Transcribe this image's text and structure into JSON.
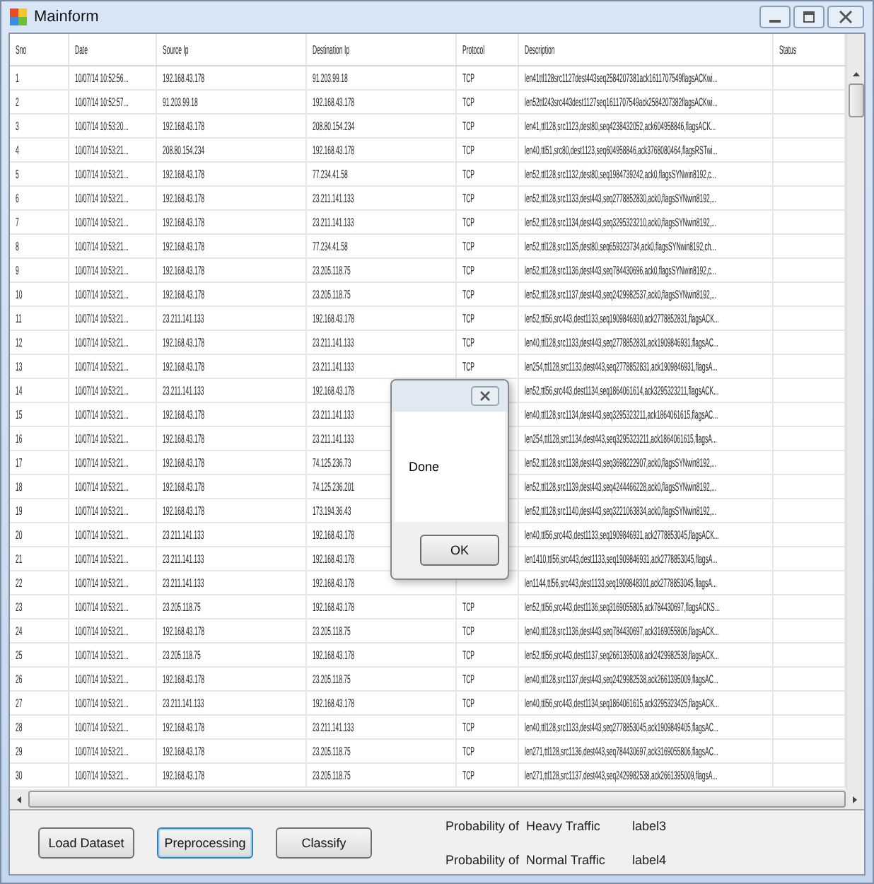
{
  "window": {
    "title": "Mainform"
  },
  "table": {
    "columns": [
      "Sno",
      "Date",
      "Source Ip",
      "Destination Ip",
      "Protocol",
      "Description",
      "Status"
    ],
    "rows": [
      {
        "sno": "1",
        "date": "10/07/14 10:52:56...",
        "source_ip": "192.168.43.178",
        "destination_ip": "91.203.99.18",
        "protocol": "TCP",
        "description": "len41ttl128src1127dest443seq2584207381ack1611707549flagsACKwi..."
      },
      {
        "sno": "2",
        "date": "10/07/14 10:52:57...",
        "source_ip": "91.203.99.18",
        "destination_ip": "192.168.43.178",
        "protocol": "TCP",
        "description": "len52ttl243src443dest1127seq1611707549ack2584207382flagsACKwi..."
      },
      {
        "sno": "3",
        "date": "10/07/14 10:53:20...",
        "source_ip": "192.168.43.178",
        "destination_ip": "208.80.154.234",
        "protocol": "TCP",
        "description": "len41,ttl128,src1123,dest80,seq4238432052,ack604958846,flagsACK..."
      },
      {
        "sno": "4",
        "date": "10/07/14 10:53:21...",
        "source_ip": "208.80.154.234",
        "destination_ip": "192.168.43.178",
        "protocol": "TCP",
        "description": "len40,ttl51,src80,dest1123,seq604958846,ack3768080464,flagsRSTwi..."
      },
      {
        "sno": "5",
        "date": "10/07/14 10:53:21...",
        "source_ip": "192.168.43.178",
        "destination_ip": "77.234.41.58",
        "protocol": "TCP",
        "description": "len52,ttl128,src1132,dest80,seq1984739242,ack0,flagsSYNwin8192,c..."
      },
      {
        "sno": "6",
        "date": "10/07/14 10:53:21...",
        "source_ip": "192.168.43.178",
        "destination_ip": "23.211.141.133",
        "protocol": "TCP",
        "description": "len52,ttl128,src1133,dest443,seq2778852830,ack0,flagsSYNwin8192,..."
      },
      {
        "sno": "7",
        "date": "10/07/14 10:53:21...",
        "source_ip": "192.168.43.178",
        "destination_ip": "23.211.141.133",
        "protocol": "TCP",
        "description": "len52,ttl128,src1134,dest443,seq3295323210,ack0,flagsSYNwin8192,..."
      },
      {
        "sno": "8",
        "date": "10/07/14 10:53:21...",
        "source_ip": "192.168.43.178",
        "destination_ip": "77.234.41.58",
        "protocol": "TCP",
        "description": "len52,ttl128,src1135,dest80,seq659323734,ack0,flagsSYNwin8192,ch..."
      },
      {
        "sno": "9",
        "date": "10/07/14 10:53:21...",
        "source_ip": "192.168.43.178",
        "destination_ip": "23.205.118.75",
        "protocol": "TCP",
        "description": "len52,ttl128,src1136,dest443,seq784430696,ack0,flagsSYNwin8192,c..."
      },
      {
        "sno": "10",
        "date": "10/07/14 10:53:21...",
        "source_ip": "192.168.43.178",
        "destination_ip": "23.205.118.75",
        "protocol": "TCP",
        "description": "len52,ttl128,src1137,dest443,seq2429982537,ack0,flagsSYNwin8192,..."
      },
      {
        "sno": "11",
        "date": "10/07/14 10:53:21...",
        "source_ip": "23.211.141.133",
        "destination_ip": "192.168.43.178",
        "protocol": "TCP",
        "description": "len52,ttl56,src443,dest1133,seq1909846930,ack2778852831,flagsACK..."
      },
      {
        "sno": "12",
        "date": "10/07/14 10:53:21...",
        "source_ip": "192.168.43.178",
        "destination_ip": "23.211.141.133",
        "protocol": "TCP",
        "description": "len40,ttl128,src1133,dest443,seq2778852831,ack1909846931,flagsAC..."
      },
      {
        "sno": "13",
        "date": "10/07/14 10:53:21...",
        "source_ip": "192.168.43.178",
        "destination_ip": "23.211.141.133",
        "protocol": "TCP",
        "description": "len254,ttl128,src1133,dest443,seq2778852831,ack1909846931,flagsA..."
      },
      {
        "sno": "14",
        "date": "10/07/14 10:53:21...",
        "source_ip": "23.211.141.133",
        "destination_ip": "192.168.43.178",
        "description": "len52,ttl56,src443,dest1134,seq1864061614,ack3295323211,flagsACK..."
      },
      {
        "sno": "15",
        "date": "10/07/14 10:53:21...",
        "source_ip": "192.168.43.178",
        "destination_ip": "23.211.141.133",
        "description": "len40,ttl128,src1134,dest443,seq3295323211,ack1864061615,flagsAC..."
      },
      {
        "sno": "16",
        "date": "10/07/14 10:53:21...",
        "source_ip": "192.168.43.178",
        "destination_ip": "23.211.141.133",
        "description": "len254,ttl128,src1134,dest443,seq3295323211,ack1864061615,flagsA..."
      },
      {
        "sno": "17",
        "date": "10/07/14 10:53:21...",
        "source_ip": "192.168.43.178",
        "destination_ip": "74.125.236.73",
        "description": "len52,ttl128,src1138,dest443,seq3698222907,ack0,flagsSYNwin8192,..."
      },
      {
        "sno": "18",
        "date": "10/07/14 10:53:21...",
        "source_ip": "192.168.43.178",
        "destination_ip": "74.125.236.201",
        "description": "len52,ttl128,src1139,dest443,seq4244466228,ack0,flagsSYNwin8192,..."
      },
      {
        "sno": "19",
        "date": "10/07/14 10:53:21...",
        "source_ip": "192.168.43.178",
        "destination_ip": "173.194.36.43",
        "description": "len52,ttl128,src1140,dest443,seq3221063834,ack0,flagsSYNwin8192,..."
      },
      {
        "sno": "20",
        "date": "10/07/14 10:53:21...",
        "source_ip": "23.211.141.133",
        "destination_ip": "192.168.43.178",
        "description": "len40,ttl56,src443,dest1133,seq1909846931,ack2778853045,flagsACK..."
      },
      {
        "sno": "21",
        "date": "10/07/14 10:53:21...",
        "source_ip": "23.211.141.133",
        "destination_ip": "192.168.43.178",
        "description": "len1410,ttl56,src443,dest1133,seq1909846931,ack2778853045,flagsA..."
      },
      {
        "sno": "22",
        "date": "10/07/14 10:53:21...",
        "source_ip": "23.211.141.133",
        "destination_ip": "192.168.43.178",
        "description": "len1144,ttl56,src443,dest1133,seq1909848301,ack2778853045,flagsA..."
      },
      {
        "sno": "23",
        "date": "10/07/14 10:53:21...",
        "source_ip": "23.205.118.75",
        "destination_ip": "192.168.43.178",
        "protocol": "TCP",
        "description": "len52,ttl56,src443,dest1136,seq3169055805,ack784430697,flagsACKS..."
      },
      {
        "sno": "24",
        "date": "10/07/14 10:53:21...",
        "source_ip": "192.168.43.178",
        "destination_ip": "23.205.118.75",
        "protocol": "TCP",
        "description": "len40,ttl128,src1136,dest443,seq784430697,ack3169055806,flagsACK..."
      },
      {
        "sno": "25",
        "date": "10/07/14 10:53:21...",
        "source_ip": "23.205.118.75",
        "destination_ip": "192.168.43.178",
        "protocol": "TCP",
        "description": "len52,ttl56,src443,dest1137,seq2661395008,ack2429982538,flagsACK..."
      },
      {
        "sno": "26",
        "date": "10/07/14 10:53:21...",
        "source_ip": "192.168.43.178",
        "destination_ip": "23.205.118.75",
        "protocol": "TCP",
        "description": "len40,ttl128,src1137,dest443,seq2429982538,ack2661395009,flagsAC..."
      },
      {
        "sno": "27",
        "date": "10/07/14 10:53:21...",
        "source_ip": "23.211.141.133",
        "destination_ip": "192.168.43.178",
        "protocol": "TCP",
        "description": "len40,ttl56,src443,dest1134,seq1864061615,ack3295323425,flagsACK..."
      },
      {
        "sno": "28",
        "date": "10/07/14 10:53:21...",
        "source_ip": "192.168.43.178",
        "destination_ip": "23.211.141.133",
        "protocol": "TCP",
        "description": "len40,ttl128,src1133,dest443,seq2778853045,ack1909849405,flagsAC..."
      },
      {
        "sno": "29",
        "date": "10/07/14 10:53:21...",
        "source_ip": "192.168.43.178",
        "destination_ip": "23.205.118.75",
        "protocol": "TCP",
        "description": "len271,ttl128,src1136,dest443,seq784430697,ack3169055806,flagsAC..."
      },
      {
        "sno": "30",
        "date": "10/07/14 10:53:21...",
        "source_ip": "192.168.43.178",
        "destination_ip": "23.205.118.75",
        "protocol": "TCP",
        "description": "len271,ttl128,src1137,dest443,seq2429982538,ack2661395009,flagsA..."
      }
    ]
  },
  "dialog": {
    "message": "Done",
    "button": "OK"
  },
  "buttons": [
    {
      "label": "Load Dataset",
      "focused": false
    },
    {
      "label": "Preprocessing",
      "focused": true
    },
    {
      "label": "Classify",
      "focused": false
    }
  ],
  "results": [
    {
      "label": "Probability of  Heavy Traffic",
      "value": "label3"
    },
    {
      "label": "Probability of  Normal Traffic",
      "value": "label4"
    }
  ]
}
